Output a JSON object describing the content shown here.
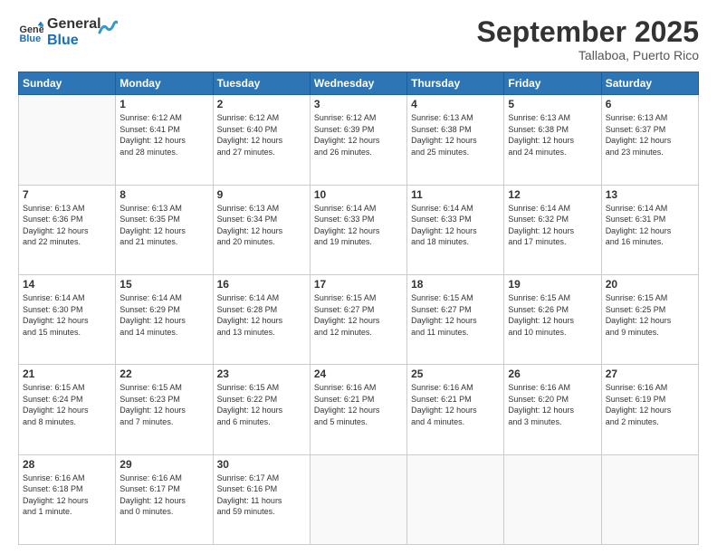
{
  "header": {
    "logo": {
      "line1": "General",
      "line2": "Blue"
    },
    "title": "September 2025",
    "subtitle": "Tallaboa, Puerto Rico"
  },
  "days_of_week": [
    "Sunday",
    "Monday",
    "Tuesday",
    "Wednesday",
    "Thursday",
    "Friday",
    "Saturday"
  ],
  "weeks": [
    [
      {
        "day": "",
        "info": ""
      },
      {
        "day": "1",
        "info": "Sunrise: 6:12 AM\nSunset: 6:41 PM\nDaylight: 12 hours\nand 28 minutes."
      },
      {
        "day": "2",
        "info": "Sunrise: 6:12 AM\nSunset: 6:40 PM\nDaylight: 12 hours\nand 27 minutes."
      },
      {
        "day": "3",
        "info": "Sunrise: 6:12 AM\nSunset: 6:39 PM\nDaylight: 12 hours\nand 26 minutes."
      },
      {
        "day": "4",
        "info": "Sunrise: 6:13 AM\nSunset: 6:38 PM\nDaylight: 12 hours\nand 25 minutes."
      },
      {
        "day": "5",
        "info": "Sunrise: 6:13 AM\nSunset: 6:38 PM\nDaylight: 12 hours\nand 24 minutes."
      },
      {
        "day": "6",
        "info": "Sunrise: 6:13 AM\nSunset: 6:37 PM\nDaylight: 12 hours\nand 23 minutes."
      }
    ],
    [
      {
        "day": "7",
        "info": "Sunrise: 6:13 AM\nSunset: 6:36 PM\nDaylight: 12 hours\nand 22 minutes."
      },
      {
        "day": "8",
        "info": "Sunrise: 6:13 AM\nSunset: 6:35 PM\nDaylight: 12 hours\nand 21 minutes."
      },
      {
        "day": "9",
        "info": "Sunrise: 6:13 AM\nSunset: 6:34 PM\nDaylight: 12 hours\nand 20 minutes."
      },
      {
        "day": "10",
        "info": "Sunrise: 6:14 AM\nSunset: 6:33 PM\nDaylight: 12 hours\nand 19 minutes."
      },
      {
        "day": "11",
        "info": "Sunrise: 6:14 AM\nSunset: 6:33 PM\nDaylight: 12 hours\nand 18 minutes."
      },
      {
        "day": "12",
        "info": "Sunrise: 6:14 AM\nSunset: 6:32 PM\nDaylight: 12 hours\nand 17 minutes."
      },
      {
        "day": "13",
        "info": "Sunrise: 6:14 AM\nSunset: 6:31 PM\nDaylight: 12 hours\nand 16 minutes."
      }
    ],
    [
      {
        "day": "14",
        "info": "Sunrise: 6:14 AM\nSunset: 6:30 PM\nDaylight: 12 hours\nand 15 minutes."
      },
      {
        "day": "15",
        "info": "Sunrise: 6:14 AM\nSunset: 6:29 PM\nDaylight: 12 hours\nand 14 minutes."
      },
      {
        "day": "16",
        "info": "Sunrise: 6:14 AM\nSunset: 6:28 PM\nDaylight: 12 hours\nand 13 minutes."
      },
      {
        "day": "17",
        "info": "Sunrise: 6:15 AM\nSunset: 6:27 PM\nDaylight: 12 hours\nand 12 minutes."
      },
      {
        "day": "18",
        "info": "Sunrise: 6:15 AM\nSunset: 6:27 PM\nDaylight: 12 hours\nand 11 minutes."
      },
      {
        "day": "19",
        "info": "Sunrise: 6:15 AM\nSunset: 6:26 PM\nDaylight: 12 hours\nand 10 minutes."
      },
      {
        "day": "20",
        "info": "Sunrise: 6:15 AM\nSunset: 6:25 PM\nDaylight: 12 hours\nand 9 minutes."
      }
    ],
    [
      {
        "day": "21",
        "info": "Sunrise: 6:15 AM\nSunset: 6:24 PM\nDaylight: 12 hours\nand 8 minutes."
      },
      {
        "day": "22",
        "info": "Sunrise: 6:15 AM\nSunset: 6:23 PM\nDaylight: 12 hours\nand 7 minutes."
      },
      {
        "day": "23",
        "info": "Sunrise: 6:15 AM\nSunset: 6:22 PM\nDaylight: 12 hours\nand 6 minutes."
      },
      {
        "day": "24",
        "info": "Sunrise: 6:16 AM\nSunset: 6:21 PM\nDaylight: 12 hours\nand 5 minutes."
      },
      {
        "day": "25",
        "info": "Sunrise: 6:16 AM\nSunset: 6:21 PM\nDaylight: 12 hours\nand 4 minutes."
      },
      {
        "day": "26",
        "info": "Sunrise: 6:16 AM\nSunset: 6:20 PM\nDaylight: 12 hours\nand 3 minutes."
      },
      {
        "day": "27",
        "info": "Sunrise: 6:16 AM\nSunset: 6:19 PM\nDaylight: 12 hours\nand 2 minutes."
      }
    ],
    [
      {
        "day": "28",
        "info": "Sunrise: 6:16 AM\nSunset: 6:18 PM\nDaylight: 12 hours\nand 1 minute."
      },
      {
        "day": "29",
        "info": "Sunrise: 6:16 AM\nSunset: 6:17 PM\nDaylight: 12 hours\nand 0 minutes."
      },
      {
        "day": "30",
        "info": "Sunrise: 6:17 AM\nSunset: 6:16 PM\nDaylight: 11 hours\nand 59 minutes."
      },
      {
        "day": "",
        "info": ""
      },
      {
        "day": "",
        "info": ""
      },
      {
        "day": "",
        "info": ""
      },
      {
        "day": "",
        "info": ""
      }
    ]
  ]
}
